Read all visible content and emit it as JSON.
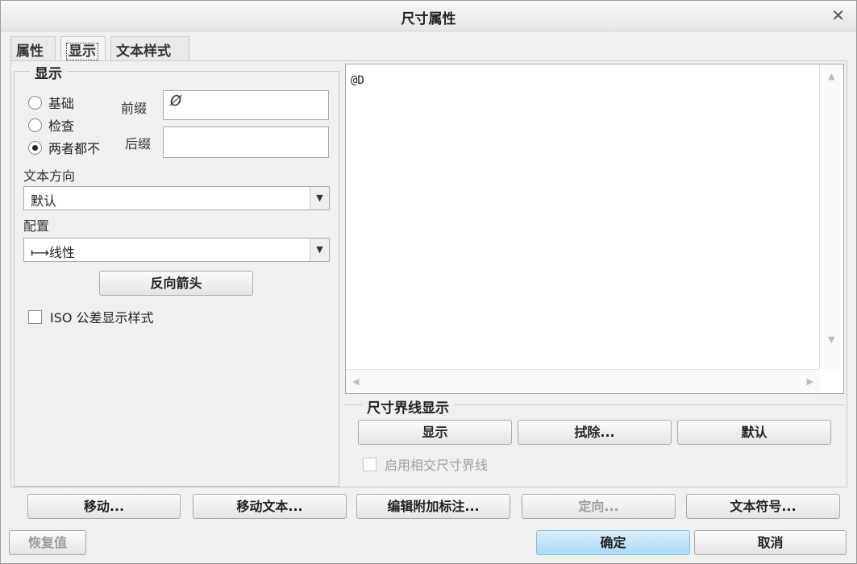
{
  "window": {
    "title": "尺寸属性",
    "close_icon": "close-icon"
  },
  "tabs": [
    {
      "label": "属性"
    },
    {
      "label": "显示"
    },
    {
      "label": "文本样式"
    }
  ],
  "display": {
    "legend": "显示",
    "radios": [
      {
        "label": "基础",
        "checked": false
      },
      {
        "label": "检查",
        "checked": false
      },
      {
        "label": "两者都不",
        "checked": true
      }
    ],
    "prefix_label": "前缀",
    "prefix_value": "Ø",
    "suffix_label": "后缀",
    "suffix_value": "",
    "text_direction_label": "文本方向",
    "text_direction_value": "默认",
    "config_label": "配置",
    "config_value": "⟼线性",
    "reverse_arrow_button": "反向箭头",
    "iso_checkbox_label": "ISO 公差显示样式"
  },
  "text_area": {
    "content": "@D"
  },
  "witness_lines": {
    "legend": "尺寸界线显示",
    "show_button": "显示",
    "erase_button": "拭除...",
    "default_button": "默认",
    "intersect_checkbox_label": "启用相交尺寸界线"
  },
  "actions": {
    "move": "移动...",
    "move_text": "移动文本...",
    "edit_attach": "编辑附加标注...",
    "orient": "定向...",
    "text_symbol": "文本符号..."
  },
  "footer": {
    "restore": "恢复值",
    "ok": "确定",
    "cancel": "取消"
  }
}
